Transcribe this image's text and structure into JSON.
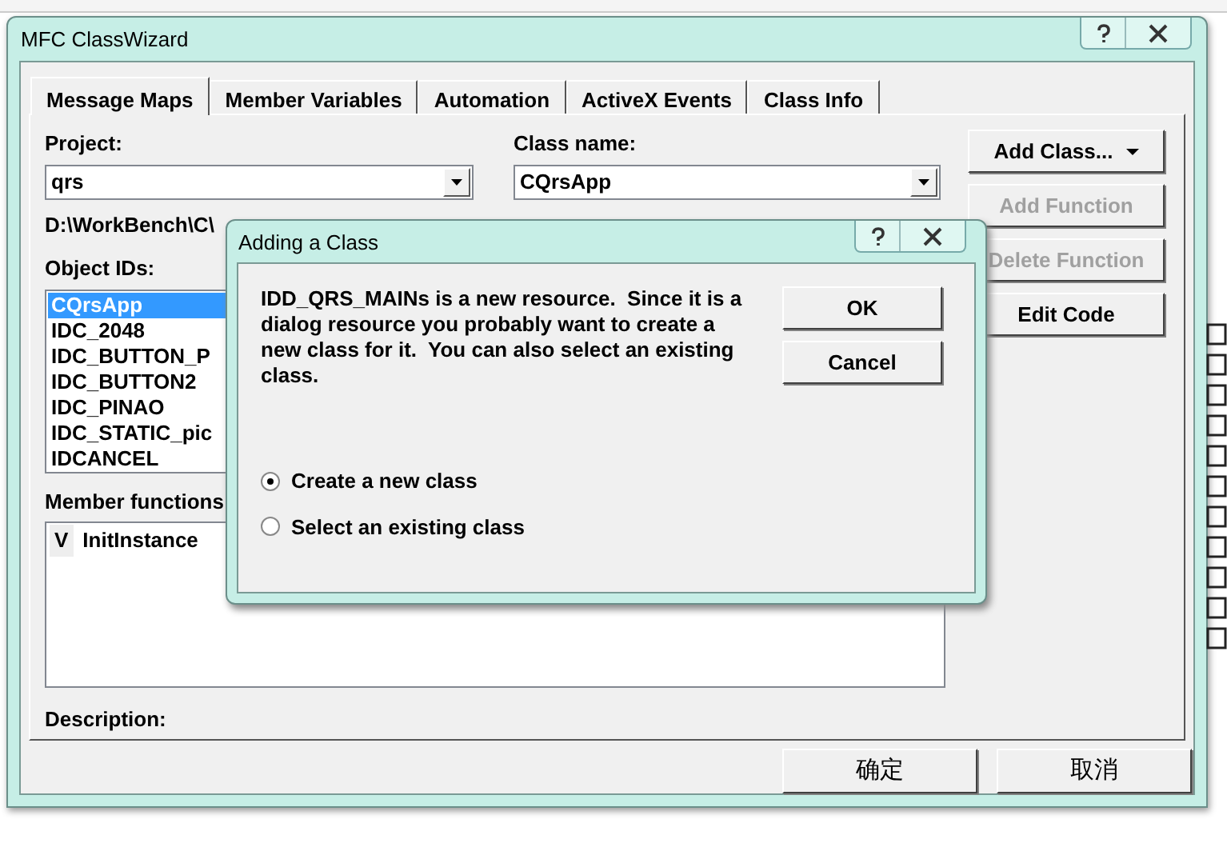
{
  "main_window": {
    "title": "MFC ClassWizard"
  },
  "tabs": [
    {
      "label": "Message Maps",
      "selected": true
    },
    {
      "label": "Member Variables",
      "selected": false
    },
    {
      "label": "Automation",
      "selected": false
    },
    {
      "label": "ActiveX Events",
      "selected": false
    },
    {
      "label": "Class Info",
      "selected": false
    }
  ],
  "project": {
    "label": "Project:",
    "value": "qrs"
  },
  "class_name": {
    "label": "Class name:",
    "value": "CQrsApp"
  },
  "path": "D:\\WorkBench\\C\\",
  "object_ids": {
    "label": "Object IDs:",
    "items": [
      {
        "text": "CQrsApp",
        "selected": true
      },
      {
        "text": "IDC_2048",
        "selected": false
      },
      {
        "text": "IDC_BUTTON_P",
        "selected": false
      },
      {
        "text": "IDC_BUTTON2",
        "selected": false
      },
      {
        "text": "IDC_PINAO",
        "selected": false
      },
      {
        "text": "IDC_STATIC_pic",
        "selected": false
      },
      {
        "text": "IDCANCEL",
        "selected": false
      }
    ]
  },
  "member_functions": {
    "label": "Member functions",
    "items": [
      {
        "marker": "V",
        "text": "InitInstance"
      }
    ]
  },
  "description": {
    "label": "Description:"
  },
  "side_buttons": [
    {
      "label": "Add Class...",
      "kind": "dropdown",
      "disabled": false
    },
    {
      "label": "Add Function",
      "kind": "plain",
      "disabled": true
    },
    {
      "label": "Delete Function",
      "kind": "plain",
      "disabled": true
    },
    {
      "label": "Edit Code",
      "kind": "plain",
      "disabled": false
    }
  ],
  "bottom_buttons": [
    "确定",
    "取消"
  ],
  "dialog": {
    "title": "Adding a Class",
    "message": "IDD_QRS_MAINs is a new resource.  Since it is a dialog resource you probably want to create a new class for it.  You can also select an existing class.",
    "buttons": [
      "OK",
      "Cancel"
    ],
    "options": [
      {
        "label": "Create a new class",
        "selected": true
      },
      {
        "label": "Select an existing class",
        "selected": false
      }
    ]
  }
}
